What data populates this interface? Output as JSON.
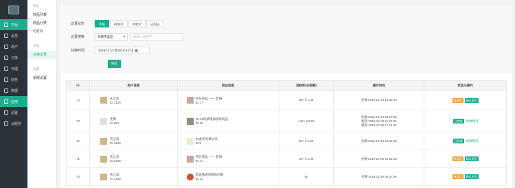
{
  "sidebar": {
    "items": [
      {
        "label": "平台",
        "icon": "monitor-icon",
        "active": true
      },
      {
        "label": "会员",
        "icon": "user-icon",
        "active": false
      },
      {
        "label": "商户",
        "icon": "shop-icon",
        "active": false
      },
      {
        "label": "订单",
        "icon": "list-icon",
        "active": false
      },
      {
        "label": "代理",
        "icon": "agent-icon",
        "active": false
      },
      {
        "label": "财务",
        "icon": "wallet-icon",
        "active": false
      },
      {
        "label": "数据",
        "icon": "chart-icon",
        "active": false
      },
      {
        "label": "应用",
        "icon": "app-icon",
        "active": true
      },
      {
        "label": "设置",
        "icon": "gear-icon",
        "active": false
      },
      {
        "label": "云服务",
        "icon": "cloud-icon",
        "active": false
      }
    ]
  },
  "subnav": {
    "group1": "商品",
    "items1": [
      "商品列表",
      "商品分类",
      "幻灯片"
    ],
    "group2": "记录",
    "items2": [
      "兑换记录"
    ],
    "group3": "设置",
    "items3": [
      "系统设置"
    ]
  },
  "filter": {
    "status_label": "记录状态",
    "status_tabs": [
      "不限",
      "待发货",
      "待收货",
      "已完成"
    ],
    "search_label": "记录搜索",
    "search_select": "关键字类型",
    "search_placeholder": "请输入关键字",
    "time_label": "兑换时间",
    "date_range": "2019-11-13 至2019-12-19",
    "filter_button": "筛选"
  },
  "table": {
    "headers": [
      "ID",
      "用户信息",
      "商品信息",
      "消耗积分(金额)",
      "操作时间",
      "状态与操作"
    ],
    "rows": [
      {
        "id": "74",
        "user_name": "天之涯",
        "user_id": "ID 3109",
        "goods_name": "积分商品 —— 普通",
        "goods_id": "ID:17",
        "cost": "50+￥1.00",
        "times": [
          "兑换:2019-12-10 10:45:34"
        ],
        "badges": [
          "待发货",
          "确认发货"
        ],
        "link": ""
      },
      {
        "id": "73",
        "user_name": "无悔",
        "user_id": "ID 982",
        "goods_name": "10.25的新增加测试商品",
        "goods_id": "ID:18",
        "cost": "140+￥8.00",
        "times": [
          "兑换:2019-12-04 09:10:18",
          "发货:2019-12-04 11:21:06",
          "收货:2019-12-05 11:14:02"
        ],
        "badges": [
          "已完成"
        ],
        "link": "修改物流"
      },
      {
        "id": "72",
        "user_name": "天之涯",
        "user_id": "ID 3109",
        "goods_name": "50金币兑换10元",
        "goods_id": "ID:5",
        "cost": "50+￥1.50",
        "times": [
          "兑换:2019-12-03 15:39:18"
        ],
        "badges": [
          "已完成"
        ],
        "link": "修改物流"
      },
      {
        "id": "71",
        "user_name": "天之涯",
        "user_id": "ID 3109",
        "goods_name": "积分商品 —— 普通",
        "goods_id": "ID:17",
        "cost": "50+￥1.00",
        "times": [
          "兑换:2019-12-03 16:38:18"
        ],
        "badges": [
          "待发货",
          "确认发货"
        ],
        "link": ""
      },
      {
        "id": "70",
        "user_name": "天之涯",
        "user_id": "ID 3109",
        "goods_name": "测试快递问题的问题",
        "goods_id": "ID:12",
        "cost": "50",
        "times": [
          "兑换:2019-11-29 09:37:59"
        ],
        "badges": [
          "待发货",
          "确认发货"
        ],
        "link": ""
      }
    ]
  }
}
